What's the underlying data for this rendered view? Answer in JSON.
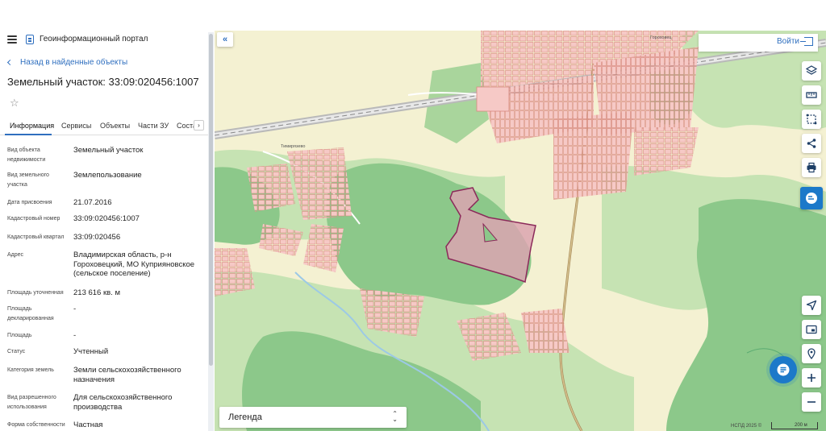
{
  "header": {
    "portal_title": "Геоинформационный портал",
    "menu_icon": "hamburger-menu-icon",
    "portal_icon": "document-icon"
  },
  "nav": {
    "back_label": "Назад в найденные объекты"
  },
  "object": {
    "title": "Земельный участок: 33:09:020456:1007"
  },
  "tabs": [
    {
      "label": "Информация",
      "active": true
    },
    {
      "label": "Сервисы",
      "active": false
    },
    {
      "label": "Объекты",
      "active": false
    },
    {
      "label": "Части ЗУ",
      "active": false
    },
    {
      "label": "Соста",
      "active": false
    }
  ],
  "tab_scroll_arrow": "›",
  "fields": [
    {
      "key": "Вид объекта недвижимости",
      "value": "Земельный участок"
    },
    {
      "key": "Вид земельного участка",
      "value": "Землепользование"
    },
    {
      "key": "Дата присвоения",
      "value": "21.07.2016"
    },
    {
      "key": "Кадастровый номер",
      "value": "33:09:020456:1007"
    },
    {
      "key": "Кадастровый квартал",
      "value": "33:09:020456"
    },
    {
      "key": "Адрес",
      "value": "Владимирская область, р-н Гороховецкий, МО Куприяновское (сельское поселение)"
    },
    {
      "key": "Площадь уточненная",
      "value": "213 616 кв. м"
    },
    {
      "key": "Площадь декларированная",
      "value": "-"
    },
    {
      "key": "Площадь",
      "value": "-"
    },
    {
      "key": "Статус",
      "value": "Учтенный"
    },
    {
      "key": "Категория земель",
      "value": "Земли сельскохозяйственного назначения"
    },
    {
      "key": "Вид разрешенного использования",
      "value": "Для сельскохозяйственного производства"
    },
    {
      "key": "Форма собственности",
      "value": "Частная"
    }
  ],
  "map": {
    "collapse_label": "«",
    "login_label": "Войти",
    "legend_label": "Легенда",
    "attribution": "НСПД 2025 ©",
    "scale_label": "200 м",
    "place_labels": [
      "Тимирязево",
      "Гороховец"
    ],
    "colors": {
      "field": "#f4f1d2",
      "forest": "#8cc88a",
      "meadow": "#c6e3b3",
      "parcel_fill": "#f6c9c6",
      "parcel_stroke": "#d9897f",
      "selected_fill": "#dba5b0",
      "selected_stroke": "#8b2a5a",
      "accent": "#1c79c9"
    },
    "tools": [
      "layers-icon",
      "ruler-icon",
      "select-area-icon",
      "share-icon",
      "print-icon",
      "chat-assistant-icon",
      "locate-arrow-icon",
      "minimap-icon",
      "geolocation-pin-icon",
      "zoom-in-icon",
      "zoom-out-icon"
    ]
  }
}
